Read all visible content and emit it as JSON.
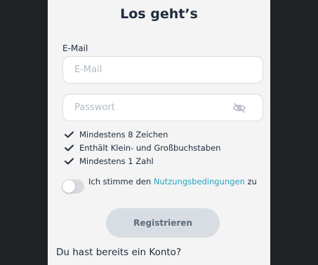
{
  "form": {
    "title": "Los geht’s",
    "email_label": "E-Mail",
    "email_placeholder": "E-Mail",
    "password_placeholder": "Passwort",
    "password_requirements": [
      "Mindestens 8 Zeichen",
      "Enthält Klein- und Großbuchstaben",
      "Mindestens 1 Zahl"
    ],
    "terms_prefix": "Ich stimme den ",
    "terms_link": "Nutzungsbedingungen",
    "terms_suffix": " zu",
    "terms_accepted": false,
    "register_button": "Registrieren",
    "login_question": "Du hast bereits ein Konto?"
  },
  "icons": {
    "password_visibility": "eye-off-icon",
    "requirement": "checkmark-icon"
  },
  "colors": {
    "background": "#1f2125",
    "panel": "#f3f4f3",
    "text": "#1f2a3c",
    "link": "#26a1c2",
    "button_disabled": "#d7dde3",
    "placeholder": "#b3bac3"
  }
}
